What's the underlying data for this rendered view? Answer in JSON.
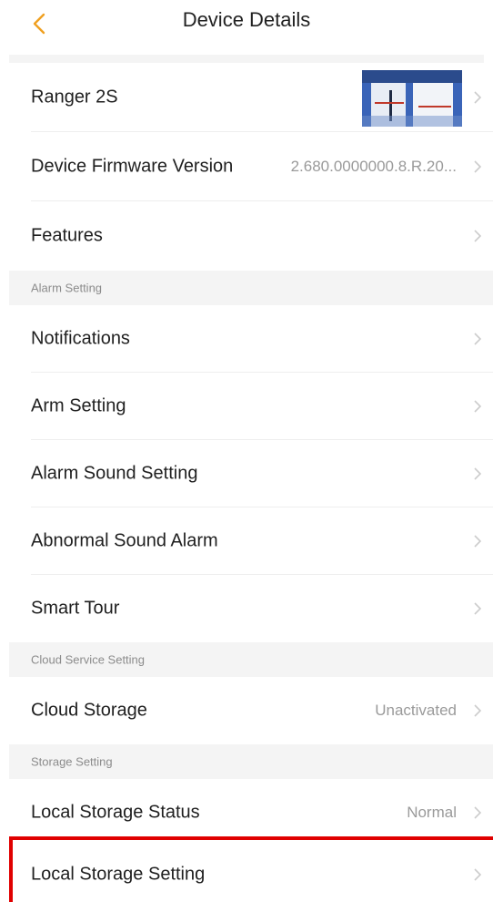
{
  "header": {
    "title": "Device Details",
    "back_icon": "chevron-left-icon",
    "accent_color": "#f0a020"
  },
  "device": {
    "name": "Ranger 2S",
    "thumbnail": "camera-snapshot-image"
  },
  "firmware": {
    "label": "Device Firmware Version",
    "value": "2.680.0000000.8.R.20..."
  },
  "features": {
    "label": "Features"
  },
  "alarm_section": {
    "title": "Alarm Setting",
    "items": [
      {
        "label": "Notifications"
      },
      {
        "label": "Arm Setting"
      },
      {
        "label": "Alarm Sound Setting"
      },
      {
        "label": "Abnormal Sound Alarm"
      },
      {
        "label": "Smart Tour"
      }
    ]
  },
  "cloud_section": {
    "title": "Cloud Service Setting",
    "item": {
      "label": "Cloud Storage",
      "value": "Unactivated"
    }
  },
  "storage_section": {
    "title": "Storage Setting",
    "items": [
      {
        "label": "Local Storage Status",
        "value": "Normal"
      },
      {
        "label": "Local Storage Setting"
      }
    ]
  },
  "icons": {
    "row_arrow": "chevron-right-icon"
  },
  "colors": {
    "highlight_box": "#e00000",
    "section_bg": "#f4f4f4",
    "muted_text": "#9a9a9a"
  }
}
